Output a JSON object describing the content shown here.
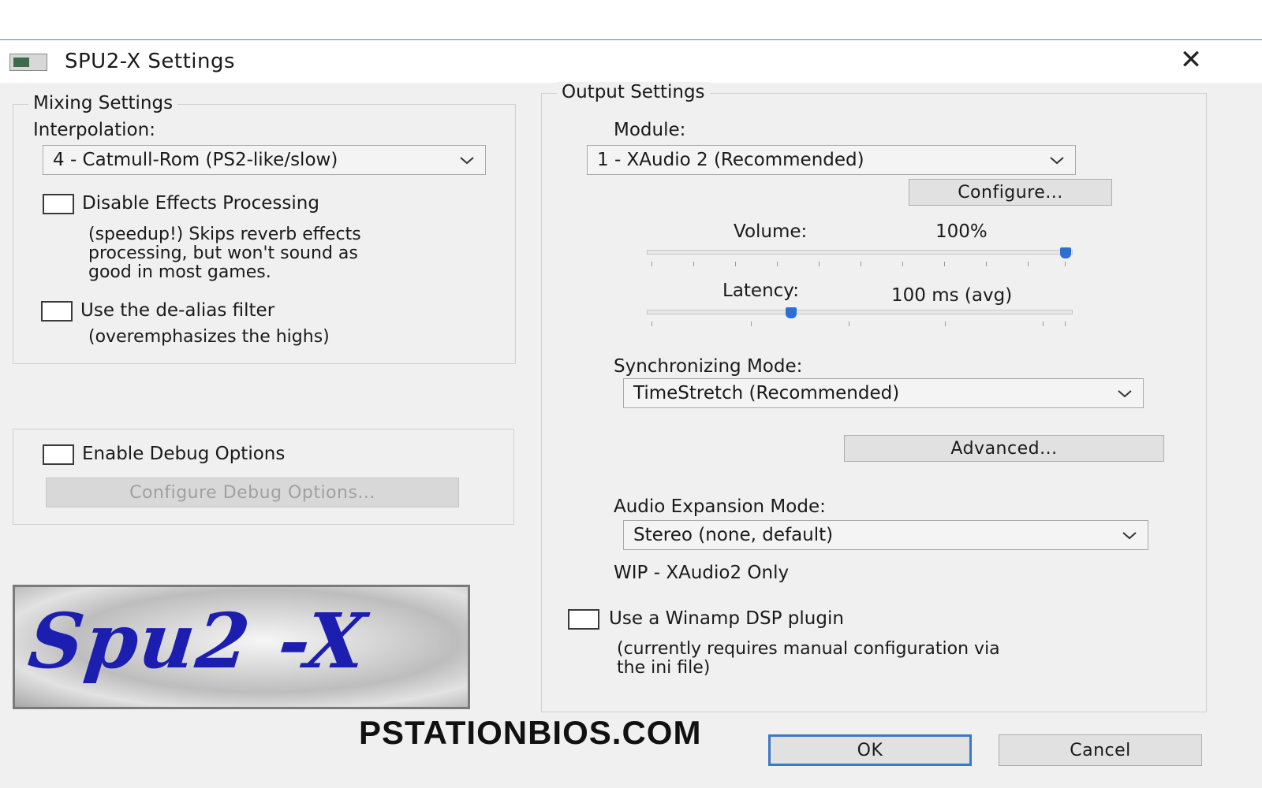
{
  "window": {
    "title": "SPU2-X Settings"
  },
  "mixing": {
    "legend": "Mixing Settings",
    "interpolation_label": "Interpolation:",
    "interpolation_value": "4 - Catmull-Rom (PS2-like/slow)",
    "disable_effects_label": "Disable Effects Processing",
    "disable_effects_checked": false,
    "disable_effects_desc": [
      "(speedup!) Skips reverb effects",
      "processing, but won't sound as",
      "good in most games."
    ],
    "dealias_label": "Use the de-alias filter",
    "dealias_checked": false,
    "dealias_desc": "(overemphasizes the highs)"
  },
  "debug": {
    "enable_label": "Enable Debug Options",
    "enable_checked": false,
    "configure_label": "Configure Debug Options..."
  },
  "output": {
    "legend": "Output Settings",
    "module_label": "Module:",
    "module_value": "1 - XAudio 2 (Recommended)",
    "configure_label": "Configure...",
    "volume_label": "Volume:",
    "volume_value": "100%",
    "volume_level": 1.0,
    "latency_label": "Latency:",
    "latency_value": "100 ms (avg)",
    "latency_level": 0.33,
    "sync_label": "Synchronizing Mode:",
    "sync_value": "TimeStretch (Recommended)",
    "advanced_label": "Advanced...",
    "expansion_label": "Audio Expansion Mode:",
    "expansion_value": "Stereo (none, default)",
    "wip_note": "WIP - XAudio2 Only",
    "winamp_label": "Use a Winamp DSP plugin",
    "winamp_checked": false,
    "winamp_desc": [
      "(currently requires manual configuration via",
      "the ini file)"
    ]
  },
  "logo": {
    "text": "Spu2 -X"
  },
  "watermark": "PSTATIONBIOS.COM",
  "buttons": {
    "ok": "OK",
    "cancel": "Cancel"
  },
  "icons": {
    "close": "close-icon",
    "chevron": "chevron-down-icon",
    "app": "app-icon"
  },
  "colors": {
    "accent": "#2f6fd1",
    "logo_text": "#1c1eb0",
    "default_button_border": "#3a78c8"
  }
}
